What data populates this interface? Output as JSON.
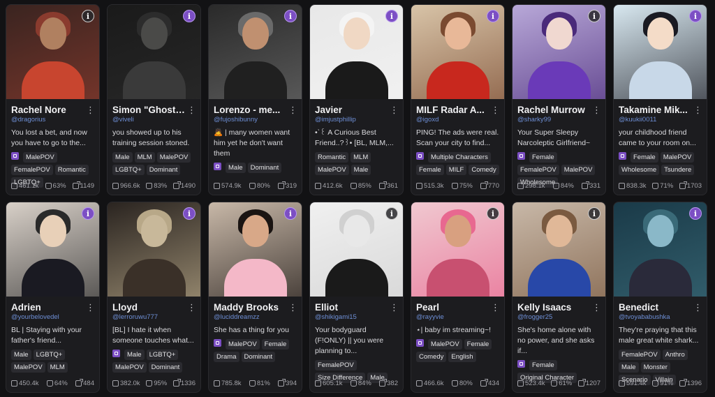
{
  "cards": [
    {
      "title": "Rachel Nore",
      "creator": "@dragorius",
      "desc": "You lost a bet, and now you have to go to the...",
      "tags": [
        "MalePOV",
        "FemalePOV",
        "Romantic",
        "LGBTQ+"
      ],
      "tag_icon": true,
      "views": "461.1k",
      "likes": "63%",
      "saves": "1149",
      "badge": "gray",
      "colors": [
        "#3a2420",
        "#8a3b2e",
        "#c8452f",
        "#b08060"
      ]
    },
    {
      "title": "Simon \"Ghost\"...",
      "creator": "@viveli",
      "desc": "you showed up to his training session stoned.",
      "tags": [
        "Male",
        "MLM",
        "MalePOV",
        "LGBTQ+",
        "Dominant"
      ],
      "tag_icon": false,
      "views": "966.6k",
      "likes": "83%",
      "saves": "1490",
      "badge": "purple",
      "colors": [
        "#1a1a1a",
        "#2c2c2c",
        "#3a3a3a",
        "#4a4a48"
      ]
    },
    {
      "title": "Lorenzo - me...",
      "creator": "@fujoshibunny",
      "desc": "🙇 | many women want him yet he don't want them",
      "tags": [
        "Male",
        "Dominant"
      ],
      "tag_icon": true,
      "views": "574.9k",
      "likes": "80%",
      "saves": "319",
      "badge": "purple",
      "colors": [
        "#2a2a2a",
        "#6a6a6a",
        "#202020",
        "#c09070"
      ]
    },
    {
      "title": "Javier",
      "creator": "@imjustphillip",
      "desc": "•ˋ꒰ A Curious Best Friend..?꒱• [BL, MLM,...",
      "tags": [
        "Romantic",
        "MLM",
        "MalePOV",
        "Male"
      ],
      "tag_icon": false,
      "views": "412.6k",
      "likes": "85%",
      "saves": "361",
      "badge": "purple",
      "colors": [
        "#e8e8e8",
        "#f4f4f4",
        "#1a1a1a",
        "#f0d8c4"
      ]
    },
    {
      "title": "MILF Radar A...",
      "creator": "@igoxd",
      "desc": "PING! The ads were real. Scan your city to find...",
      "tags": [
        "Multiple Characters",
        "Female",
        "MILF",
        "Comedy"
      ],
      "tag_icon": true,
      "views": "515.3k",
      "likes": "75%",
      "saves": "770",
      "badge": "purple",
      "colors": [
        "#d8c4a8",
        "#7a4a30",
        "#c8281e",
        "#e8b898"
      ]
    },
    {
      "title": "Rachel Murrow",
      "creator": "@sharky99",
      "desc": "Your Super Sleepy Narcoleptic Girlfriend~",
      "tags": [
        "Female",
        "FemalePOV",
        "MalePOV",
        "Wholesome"
      ],
      "tag_icon": true,
      "views": "298.1k",
      "likes": "84%",
      "saves": "331",
      "badge": "gray",
      "colors": [
        "#b8a8d8",
        "#4a2a7a",
        "#6a3ab8",
        "#f0d8d0"
      ]
    },
    {
      "title": "Takamine Mik...",
      "creator": "@kuukii0011",
      "desc": "your childhood friend came to your room on...",
      "tags": [
        "Female",
        "MalePOV",
        "Wholesome",
        "Tsundere"
      ],
      "tag_icon": true,
      "views": "838.3k",
      "likes": "71%",
      "saves": "1703",
      "badge": "purple",
      "colors": [
        "#d8e8f0",
        "#1a1a22",
        "#c8d8e8",
        "#f4dcc8"
      ]
    },
    {
      "title": "Adrien",
      "creator": "@yourbelovedel",
      "desc": "BL | Staying with your father's friend...",
      "tags": [
        "Male",
        "LGBTQ+",
        "MalePOV",
        "MLM"
      ],
      "tag_icon": false,
      "views": "450.4k",
      "likes": "64%",
      "saves": "484",
      "badge": "purple",
      "colors": [
        "#d8d0c8",
        "#2a2a2a",
        "#1a1a22",
        "#e8d0b8"
      ]
    },
    {
      "title": "Lloyd",
      "creator": "@lerroruwu777",
      "desc": "[BL] I hate it when someone touches what...",
      "tags": [
        "Male",
        "LGBTQ+",
        "MalePOV",
        "Dominant"
      ],
      "tag_icon": true,
      "views": "382.0k",
      "likes": "95%",
      "saves": "1336",
      "badge": "purple",
      "colors": [
        "#2a2420",
        "#b8a888",
        "#3a3028",
        "#c8b89a"
      ]
    },
    {
      "title": "Maddy Brooks",
      "creator": "@luciddreamzz",
      "desc": "She has a thing for you",
      "tags": [
        "MalePOV",
        "Female",
        "Drama",
        "Dominant"
      ],
      "tag_icon": true,
      "views": "785.8k",
      "likes": "81%",
      "saves": "394",
      "badge": "purple",
      "colors": [
        "#c8b8a8",
        "#1a1412",
        "#f4b8c8",
        "#d8a888"
      ]
    },
    {
      "title": "Elliot",
      "creator": "@shikigami15",
      "desc": "Your bodyguard (F!ONLY) || you were planning to...",
      "tags": [
        "FemalePOV",
        "Size Difference",
        "Male"
      ],
      "tag_icon": false,
      "views": "605.1k",
      "likes": "84%",
      "saves": "382",
      "badge": "gray",
      "colors": [
        "#f0f0f0",
        "#d0d0d0",
        "#1a1a1a",
        "#e8e8e8"
      ]
    },
    {
      "title": "Pearl",
      "creator": "@rayyvie",
      "desc": "⋆| baby im streaming~!",
      "tags": [
        "MalePOV",
        "Female",
        "Comedy",
        "English"
      ],
      "tag_icon": true,
      "views": "466.6k",
      "likes": "80%",
      "saves": "434",
      "badge": "gray",
      "colors": [
        "#f0c8d0",
        "#e86890",
        "#c85070",
        "#d8a080"
      ]
    },
    {
      "title": "Kelly Isaacs",
      "creator": "@frogger25",
      "desc": "She's home alone with no power, and she asks if...",
      "tags": [
        "Female",
        "Original Character"
      ],
      "tag_icon": true,
      "views": "523.4k",
      "likes": "61%",
      "saves": "1207",
      "badge": "gray",
      "colors": [
        "#c8b8a8",
        "#7a5a40",
        "#2848a8",
        "#e0b898"
      ]
    },
    {
      "title": "Benedict",
      "creator": "@tvoyababushka",
      "desc": "They're praying that this male great white shark...",
      "tags": [
        "FemalePOV",
        "Anthro",
        "Male",
        "Monster",
        "Scenario",
        "Villain"
      ],
      "tag_icon": false,
      "views": "591.4k",
      "likes": "91%",
      "saves": "1396",
      "badge": "purple",
      "colors": [
        "#1a3a48",
        "#3a6a78",
        "#2a2a3a",
        "#8ab8c8"
      ]
    }
  ]
}
